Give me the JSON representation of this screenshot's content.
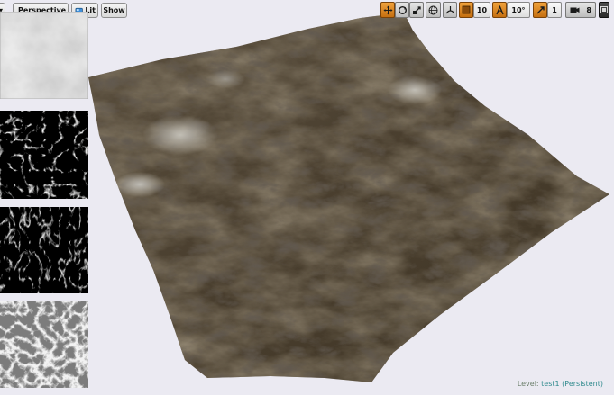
{
  "viewport": {
    "view_mode": "Perspective",
    "lighting_mode": "Lit",
    "show_label": "Show"
  },
  "toolbar": {
    "grid_snap_value": "10",
    "rotation_snap_value": "10°",
    "scale_snap_value": "1",
    "camera_speed_value": "8"
  },
  "level_status": {
    "prefix": "Level:",
    "level_name": "test1",
    "persistent_label": "(Persistent)"
  },
  "thumbnails": [
    {
      "name": "heightmap-thumbnail"
    },
    {
      "name": "flowmap-thumbnail"
    },
    {
      "name": "erosion-thumbnail"
    },
    {
      "name": "slope-thumbnail"
    }
  ],
  "colors": {
    "viewport_background": "#ebeaf2",
    "terrain_base": "#4b4030",
    "accent_orange": "#e08a1e",
    "level_name_color": "#2f8a8d"
  }
}
